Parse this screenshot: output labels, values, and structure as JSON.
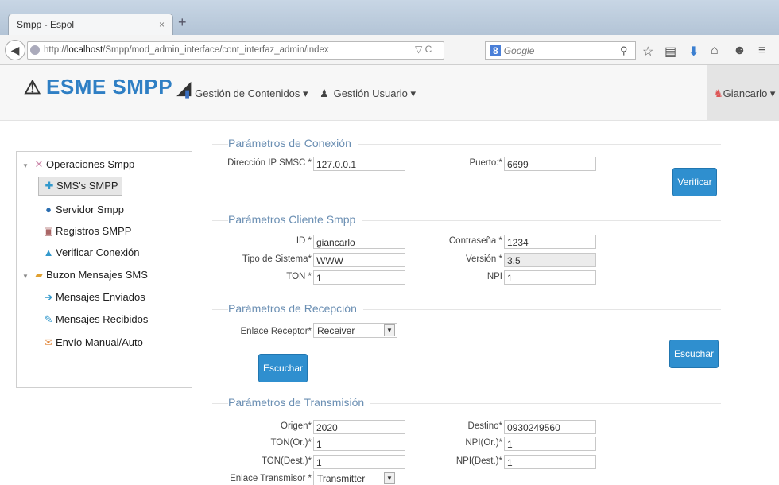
{
  "browser": {
    "tab_title": "Smpp - Espol",
    "url_prefix": "http://",
    "url_host": "localhost",
    "url_path": "/Smpp/mod_admin_interface/cont_interfaz_admin/index",
    "search_placeholder": "Google",
    "search_engine": "8"
  },
  "app": {
    "brand": "ESME SMPP",
    "menu_contents": "Gestión de Contenidos",
    "menu_users": "Gestión Usuario",
    "user": "Giancarlo"
  },
  "sidebar": {
    "items": [
      {
        "label": "Operaciones Smpp"
      },
      {
        "label": "SMS's SMPP"
      },
      {
        "label": "Servidor Smpp"
      },
      {
        "label": "Registros SMPP"
      },
      {
        "label": "Verificar Conexión"
      },
      {
        "label": "Buzon Mensajes SMS"
      },
      {
        "label": "Mensajes Enviados"
      },
      {
        "label": "Mensajes Recibidos"
      },
      {
        "label": "Envío Manual/Auto"
      }
    ]
  },
  "conexion": {
    "legend": "Parámetros de Conexión",
    "ip_label": "Dirección IP SMSC *",
    "ip_value": "127.0.0.1",
    "port_label": "Puerto:*",
    "port_value": "6699",
    "verify": "Verificar"
  },
  "cliente": {
    "legend": "Parámetros Cliente Smpp",
    "id_label": "ID *",
    "id_value": "giancarlo",
    "pass_label": "Contraseña *",
    "pass_value": "1234",
    "tipo_label": "Tipo de Sistema*",
    "tipo_value": "WWW",
    "version_label": "Versión *",
    "version_value": "3.5",
    "ton_label": "TON *",
    "ton_value": "1",
    "npi_label": "NPI",
    "npi_value": "1"
  },
  "recepcion": {
    "legend": "Parámetros de Recepción",
    "enlace_label": "Enlace Receptor*",
    "enlace_value": "Receiver",
    "listen": "Escuchar",
    "listen2": "Escuchar"
  },
  "transmision": {
    "legend": "Parámetros de Transmisión",
    "origen_label": "Origen*",
    "origen_value": "2020",
    "destino_label": "Destino*",
    "destino_value": "0930249560",
    "tonor_label": "TON(Or.)*",
    "tonor_value": "1",
    "npior_label": "NPI(Or.)*",
    "npior_value": "1",
    "tondest_label": "TON(Dest.)*",
    "tondest_value": "1",
    "npidest_label": "NPI(Dest.)*",
    "npidest_value": "1",
    "enlace_label": "Enlace Transmisor *",
    "enlace_value": "Transmitter"
  }
}
